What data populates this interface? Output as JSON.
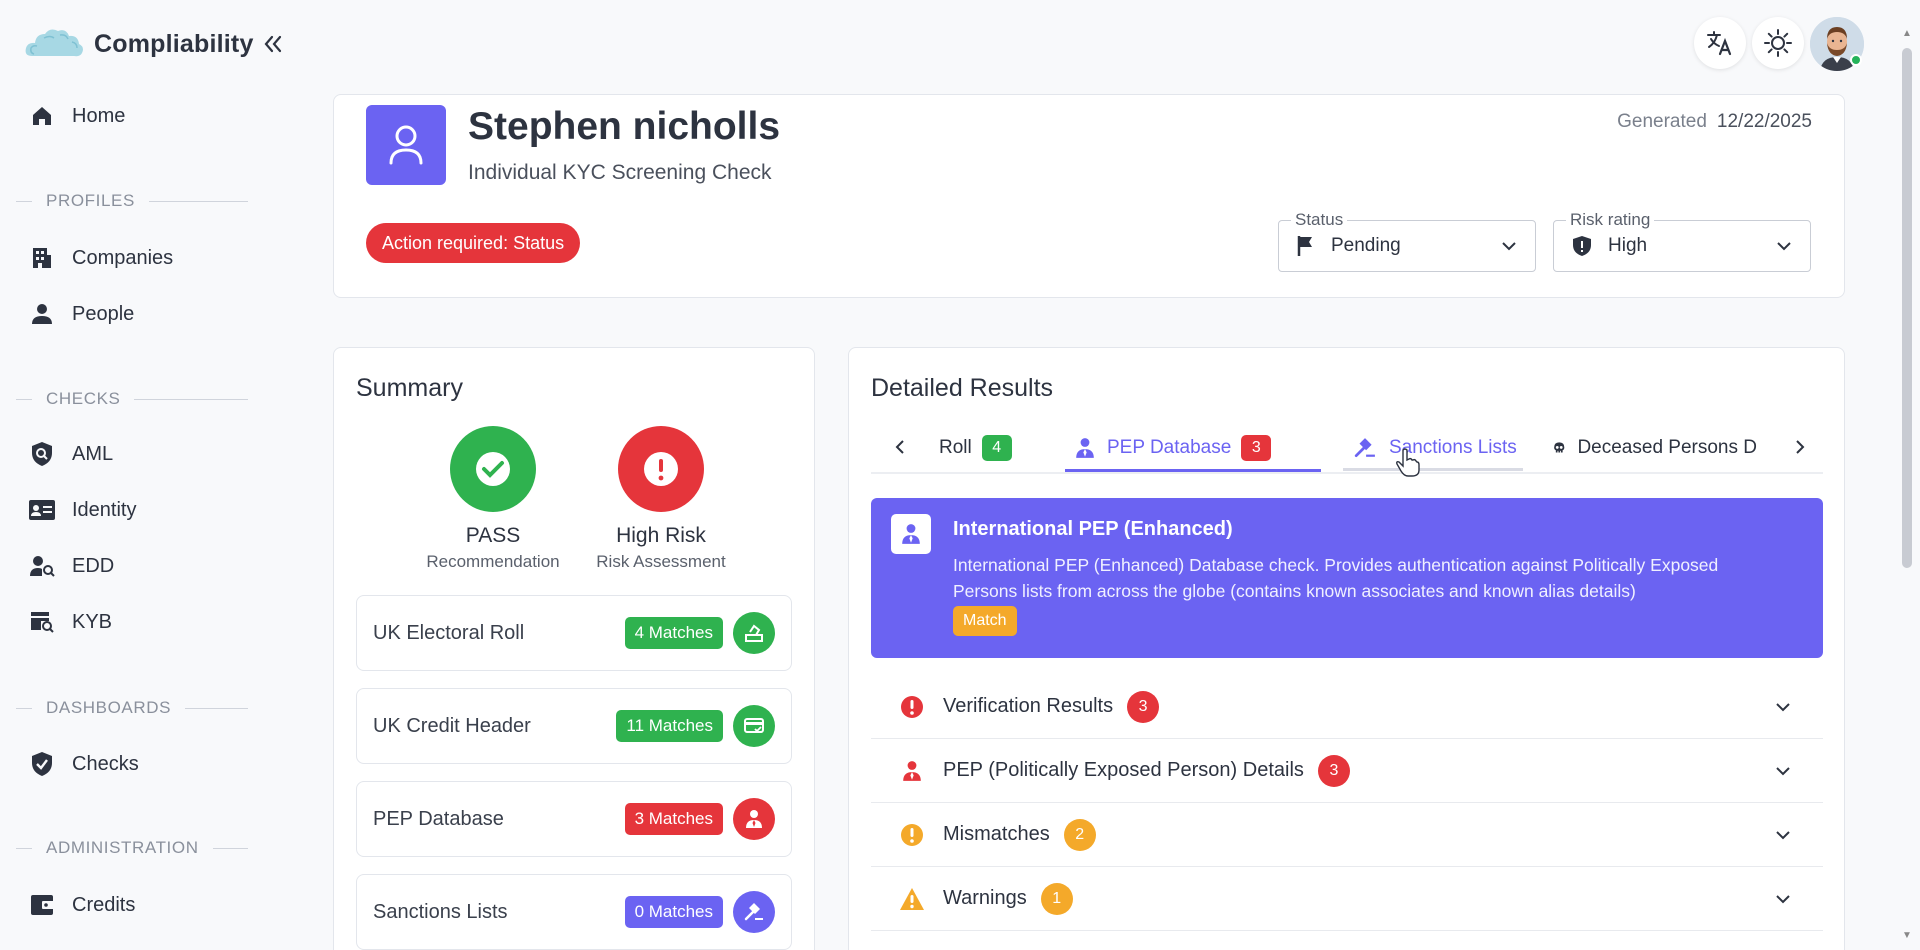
{
  "brand": {
    "name": "Compliability"
  },
  "nav": {
    "home": "Home",
    "profiles_section": "PROFILES",
    "companies": "Companies",
    "people": "People",
    "checks_section": "CHECKS",
    "aml": "AML",
    "identity": "Identity",
    "edd": "EDD",
    "kyb": "KYB",
    "dashboards_section": "DASHBOARDS",
    "checks": "Checks",
    "administration_section": "ADMINISTRATION",
    "credits": "Credits"
  },
  "header": {
    "name": "Stephen nicholls",
    "subtitle": "Individual KYC Screening Check",
    "generated_label": "Generated",
    "generated_date": "12/22/2025",
    "action_required": "Action required: Status",
    "status": {
      "label": "Status",
      "value": "Pending"
    },
    "risk": {
      "label": "Risk rating",
      "value": "High"
    }
  },
  "summary": {
    "title": "Summary",
    "recommendation": {
      "value": "PASS",
      "label": "Recommendation"
    },
    "risk": {
      "value": "High Risk",
      "label": "Risk Assessment"
    },
    "rows": [
      {
        "name": "UK Electoral Roll",
        "matches": "4 Matches"
      },
      {
        "name": "UK Credit Header",
        "matches": "11 Matches"
      },
      {
        "name": "PEP Database",
        "matches": "3 Matches"
      },
      {
        "name": "Sanctions Lists",
        "matches": "0 Matches"
      }
    ]
  },
  "detail": {
    "title": "Detailed Results",
    "tabs": [
      {
        "label": "Roll",
        "count": "4"
      },
      {
        "label": "PEP Database",
        "count": "3"
      },
      {
        "label": "Sanctions Lists"
      },
      {
        "label": "Deceased Persons D"
      }
    ],
    "banner": {
      "title": "International PEP (Enhanced)",
      "description": "International PEP (Enhanced) Database check. Provides authentication against Politically Exposed Persons lists from across the globe (contains known associates and known alias details)",
      "status": "Match"
    },
    "sections": [
      {
        "title": "Verification Results",
        "count": "3"
      },
      {
        "title": "PEP (Politically Exposed Person) Details",
        "count": "3"
      },
      {
        "title": "Mismatches",
        "count": "2"
      },
      {
        "title": "Warnings",
        "count": "1"
      }
    ]
  },
  "colors": {
    "accent": "#6b63f2",
    "success": "#2fb24f",
    "danger": "#e5353b",
    "warning": "#f4a92a"
  }
}
